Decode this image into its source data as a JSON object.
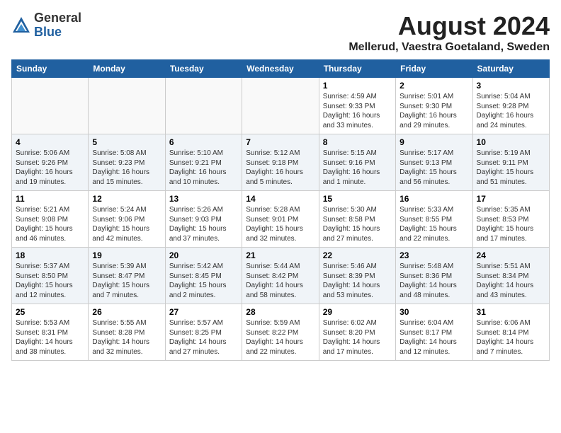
{
  "header": {
    "logo_general": "General",
    "logo_blue": "Blue",
    "month_title": "August 2024",
    "location": "Mellerud, Vaestra Goetaland, Sweden"
  },
  "days_of_week": [
    "Sunday",
    "Monday",
    "Tuesday",
    "Wednesday",
    "Thursday",
    "Friday",
    "Saturday"
  ],
  "weeks": [
    [
      {
        "day": "",
        "info": ""
      },
      {
        "day": "",
        "info": ""
      },
      {
        "day": "",
        "info": ""
      },
      {
        "day": "",
        "info": ""
      },
      {
        "day": "1",
        "info": "Sunrise: 4:59 AM\nSunset: 9:33 PM\nDaylight: 16 hours\nand 33 minutes."
      },
      {
        "day": "2",
        "info": "Sunrise: 5:01 AM\nSunset: 9:30 PM\nDaylight: 16 hours\nand 29 minutes."
      },
      {
        "day": "3",
        "info": "Sunrise: 5:04 AM\nSunset: 9:28 PM\nDaylight: 16 hours\nand 24 minutes."
      }
    ],
    [
      {
        "day": "4",
        "info": "Sunrise: 5:06 AM\nSunset: 9:26 PM\nDaylight: 16 hours\nand 19 minutes."
      },
      {
        "day": "5",
        "info": "Sunrise: 5:08 AM\nSunset: 9:23 PM\nDaylight: 16 hours\nand 15 minutes."
      },
      {
        "day": "6",
        "info": "Sunrise: 5:10 AM\nSunset: 9:21 PM\nDaylight: 16 hours\nand 10 minutes."
      },
      {
        "day": "7",
        "info": "Sunrise: 5:12 AM\nSunset: 9:18 PM\nDaylight: 16 hours\nand 5 minutes."
      },
      {
        "day": "8",
        "info": "Sunrise: 5:15 AM\nSunset: 9:16 PM\nDaylight: 16 hours\nand 1 minute."
      },
      {
        "day": "9",
        "info": "Sunrise: 5:17 AM\nSunset: 9:13 PM\nDaylight: 15 hours\nand 56 minutes."
      },
      {
        "day": "10",
        "info": "Sunrise: 5:19 AM\nSunset: 9:11 PM\nDaylight: 15 hours\nand 51 minutes."
      }
    ],
    [
      {
        "day": "11",
        "info": "Sunrise: 5:21 AM\nSunset: 9:08 PM\nDaylight: 15 hours\nand 46 minutes."
      },
      {
        "day": "12",
        "info": "Sunrise: 5:24 AM\nSunset: 9:06 PM\nDaylight: 15 hours\nand 42 minutes."
      },
      {
        "day": "13",
        "info": "Sunrise: 5:26 AM\nSunset: 9:03 PM\nDaylight: 15 hours\nand 37 minutes."
      },
      {
        "day": "14",
        "info": "Sunrise: 5:28 AM\nSunset: 9:01 PM\nDaylight: 15 hours\nand 32 minutes."
      },
      {
        "day": "15",
        "info": "Sunrise: 5:30 AM\nSunset: 8:58 PM\nDaylight: 15 hours\nand 27 minutes."
      },
      {
        "day": "16",
        "info": "Sunrise: 5:33 AM\nSunset: 8:55 PM\nDaylight: 15 hours\nand 22 minutes."
      },
      {
        "day": "17",
        "info": "Sunrise: 5:35 AM\nSunset: 8:53 PM\nDaylight: 15 hours\nand 17 minutes."
      }
    ],
    [
      {
        "day": "18",
        "info": "Sunrise: 5:37 AM\nSunset: 8:50 PM\nDaylight: 15 hours\nand 12 minutes."
      },
      {
        "day": "19",
        "info": "Sunrise: 5:39 AM\nSunset: 8:47 PM\nDaylight: 15 hours\nand 7 minutes."
      },
      {
        "day": "20",
        "info": "Sunrise: 5:42 AM\nSunset: 8:45 PM\nDaylight: 15 hours\nand 2 minutes."
      },
      {
        "day": "21",
        "info": "Sunrise: 5:44 AM\nSunset: 8:42 PM\nDaylight: 14 hours\nand 58 minutes."
      },
      {
        "day": "22",
        "info": "Sunrise: 5:46 AM\nSunset: 8:39 PM\nDaylight: 14 hours\nand 53 minutes."
      },
      {
        "day": "23",
        "info": "Sunrise: 5:48 AM\nSunset: 8:36 PM\nDaylight: 14 hours\nand 48 minutes."
      },
      {
        "day": "24",
        "info": "Sunrise: 5:51 AM\nSunset: 8:34 PM\nDaylight: 14 hours\nand 43 minutes."
      }
    ],
    [
      {
        "day": "25",
        "info": "Sunrise: 5:53 AM\nSunset: 8:31 PM\nDaylight: 14 hours\nand 38 minutes."
      },
      {
        "day": "26",
        "info": "Sunrise: 5:55 AM\nSunset: 8:28 PM\nDaylight: 14 hours\nand 32 minutes."
      },
      {
        "day": "27",
        "info": "Sunrise: 5:57 AM\nSunset: 8:25 PM\nDaylight: 14 hours\nand 27 minutes."
      },
      {
        "day": "28",
        "info": "Sunrise: 5:59 AM\nSunset: 8:22 PM\nDaylight: 14 hours\nand 22 minutes."
      },
      {
        "day": "29",
        "info": "Sunrise: 6:02 AM\nSunset: 8:20 PM\nDaylight: 14 hours\nand 17 minutes."
      },
      {
        "day": "30",
        "info": "Sunrise: 6:04 AM\nSunset: 8:17 PM\nDaylight: 14 hours\nand 12 minutes."
      },
      {
        "day": "31",
        "info": "Sunrise: 6:06 AM\nSunset: 8:14 PM\nDaylight: 14 hours\nand 7 minutes."
      }
    ]
  ]
}
